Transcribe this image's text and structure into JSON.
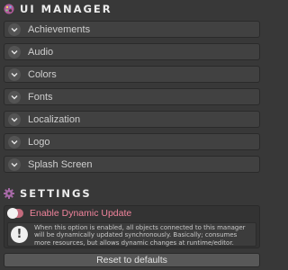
{
  "ui_manager": {
    "title": "UI MANAGER",
    "icon": "palette-icon",
    "foldouts": [
      {
        "label": "Achievements"
      },
      {
        "label": "Audio"
      },
      {
        "label": "Colors"
      },
      {
        "label": "Fonts"
      },
      {
        "label": "Localization"
      },
      {
        "label": "Logo"
      },
      {
        "label": "Splash Screen"
      }
    ]
  },
  "settings": {
    "title": "SETTINGS",
    "icon": "gear-icon",
    "toggle": {
      "label": "Enable Dynamic Update",
      "enabled": true,
      "accent": "#f0849c"
    },
    "info_icon": "exclamation-icon",
    "info_text": "When this option is enabled, all objects connected to this manager will be dynamically updated synchronously. Basically; consumes more resources, but allows dynamic changes at runtime/editor.",
    "reset_label": "Reset to defaults"
  }
}
